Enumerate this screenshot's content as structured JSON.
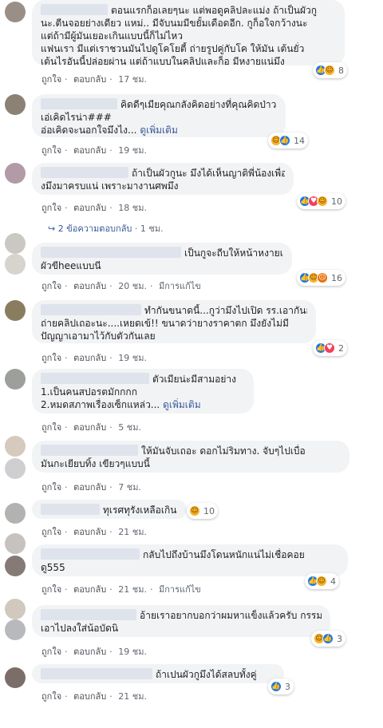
{
  "actions": {
    "like": "ถูกใจ",
    "reply": "ตอบกลับ",
    "edited": "มีการแก้ไข",
    "see_more": "ดูเพิ่มเติม"
  },
  "comments": [
    {
      "lines": [
        "ตอนแรกก็อเลยๆนะ แต่พอดูคลิปละแม่ง ถ้าเป็นผัวกู",
        "นะ.ตีนจอยย่างเดียว แหม่.. มีจับนมมีขยั้มเดือดอีก. กูก็อใจกว้างนะ",
        "แต่ถ้ามีผู้มันเยอะเกินแบบนี้ก็ไม่ไหว",
        "แฟนเรา มีแต่เราชวนมันไปดูโคโยตี้ ถ่ายรูปคู่กับโค ให้มัน เต้นยั่ว",
        "เต้นไรอันนี้ปล่อยผ่าน แต่ถ้าแบบในคลิปและก็อ มีหงายแน่มึง"
      ],
      "time": "17 ชม.",
      "reaction_count": "8"
    },
    {
      "lines": [
        "คิดดีๆเมียคุณกลังคิดอย่างที่คุณคิดป่าว",
        "เอ่เคิดไรน่า###",
        "อ่อเคิดจะนอกใจมึงไง..."
      ],
      "time": "19 ชม.",
      "reaction_count": "14"
    },
    {
      "lines": [
        "ถ้าเป็นผัวกูนะ มึงได้เห็นญาติพี่น้องเพื่อนพ่อ",
        "งมึงมาครบแน่ เพราะมางานศพมึง"
      ],
      "time": "18 ชม.",
      "reaction_count": "10",
      "replies_text": "2 ข้อความตอบกลับ",
      "replies_time": "1 ชม."
    },
    {
      "lines": [
        "เป็นกูจะถีบให้หน้าหงายเลย",
        "ผัวขีheeแบบนี"
      ],
      "time": "20 ชม.",
      "reaction_count": "16"
    },
    {
      "lines": [
        "ทำกันขนาดนี้...กูว่ามึงไปเปิด รร.เอากันสามคน",
        "ถ่ายคลิปเถอะนะ....เหยดเข้!! ขนาดว่ายางราคาตก มึงยังไม่มี",
        "ปัญญาเอามาไว้กับตัวกันเลย"
      ],
      "time": "19 ชม.",
      "reaction_count": "2"
    },
    {
      "lines": [
        "ตัวเมียน่ะมีสามอย่าง",
        "1.เป็นคนสปอรตมักกกก",
        "2.หมดสภาพเรื่องเซ็กแหล่ว..."
      ],
      "time": "5 ชม."
    },
    {
      "lines": [
        "ให้มันจับเถอะ ดอกไม่ริมทาง. จับๆไปเบื่อ",
        "มันกะเยียบทิ้ง เขียวๆแบบนี้"
      ],
      "time": "7 ชม."
    },
    {
      "lines": [
        "ทุเรศทุรังเหลือเกิน"
      ],
      "time": "21 ชม.",
      "reaction_count": "10"
    },
    {
      "lines": [
        "กลับไปถึงบ้านมึงโดนหนักแน่ไม่เชื่อคอย",
        "ดู555"
      ],
      "time": "21 ชม.",
      "reaction_count": "4"
    },
    {
      "lines": [
        "อ้ายเราอยากบอกว่าผมหาแข็งแล้วครับ กรรม",
        "เอาไปลงใส่น้อบัดนิ"
      ],
      "time": "19 ชม.",
      "reaction_count": "3"
    },
    {
      "lines": [
        "ถ้าเปนผัวกูมึงได้สลบทั้งคู่"
      ],
      "time": "21 ชม.",
      "reaction_count": "3"
    }
  ]
}
